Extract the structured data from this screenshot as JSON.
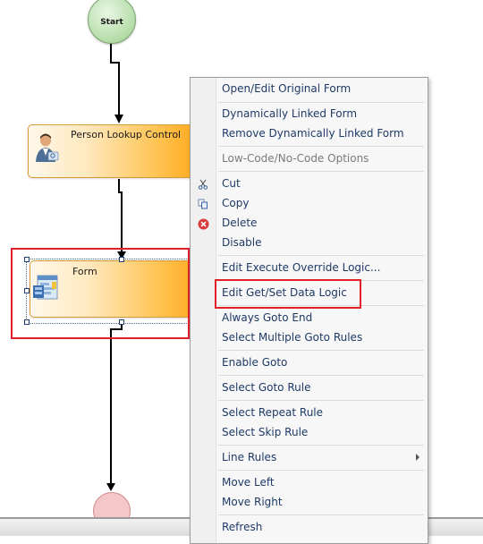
{
  "workflow": {
    "start_label": "Start",
    "person_node_title": "Person Lookup Control",
    "form_node_title": "Form"
  },
  "menu": {
    "open_edit_original_form": "Open/Edit Original Form",
    "dynamically_linked_form": "Dynamically Linked Form",
    "remove_dynamically_linked_form": "Remove Dynamically Linked Form",
    "low_code_options": "Low-Code/No-Code Options",
    "cut": "Cut",
    "copy": "Copy",
    "delete": "Delete",
    "disable": "Disable",
    "edit_execute_override_logic": "Edit Execute Override Logic...",
    "edit_get_set_data_logic": "Edit Get/Set Data Logic",
    "always_goto_end": "Always Goto End",
    "select_multiple_goto_rules": "Select Multiple Goto Rules",
    "enable_goto": "Enable Goto",
    "select_goto_rule": "Select Goto Rule",
    "select_repeat_rule": "Select Repeat Rule",
    "select_skip_rule": "Select Skip Rule",
    "line_rules": "Line Rules",
    "move_left": "Move Left",
    "move_right": "Move Right",
    "refresh": "Refresh"
  },
  "icons": {
    "cut": "scissors-icon",
    "copy": "copy-icon",
    "delete": "delete-icon",
    "line_rules": "submenu-arrow-icon",
    "person_node": "person-icon",
    "form_node": "form-icon"
  },
  "colors": {
    "highlight": "#e3202a",
    "menu_text": "#1e3a66",
    "node_orange": "#ffa81a",
    "start_green": "#bfe2b4"
  }
}
